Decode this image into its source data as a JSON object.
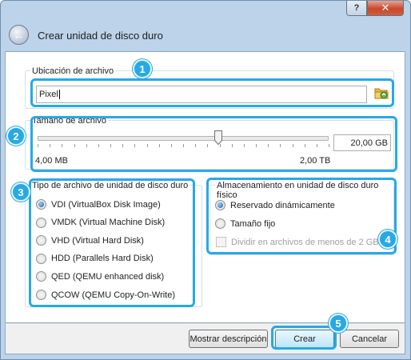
{
  "window": {
    "title": "Crear unidad de disco duro",
    "help_label": "?",
    "close_label": "✕"
  },
  "file_location": {
    "group_label": "Ubicación de archivo",
    "value": "Pixel",
    "browse_icon": "folder-icon"
  },
  "file_size": {
    "group_label": "Tamaño de archivo",
    "value": "20,00 GB",
    "min_label": "4,00 MB",
    "max_label": "2,00 TB",
    "slider_fraction": 0.62
  },
  "file_type": {
    "group_label": "Tipo de archivo de unidad de disco duro",
    "options": [
      {
        "label": "VDI (VirtualBox Disk Image)",
        "checked": true
      },
      {
        "label": "VMDK (Virtual Machine Disk)",
        "checked": false
      },
      {
        "label": "VHD (Virtual Hard Disk)",
        "checked": false
      },
      {
        "label": "HDD (Parallels Hard Disk)",
        "checked": false
      },
      {
        "label": "QED (QEMU enhanced disk)",
        "checked": false
      },
      {
        "label": "QCOW (QEMU Copy-On-Write)",
        "checked": false
      }
    ]
  },
  "storage": {
    "group_label": "Almacenamiento en unidad de disco duro físico",
    "options": [
      {
        "label": "Reservado dinámicamente",
        "checked": true
      },
      {
        "label": "Tamaño fijo",
        "checked": false
      }
    ],
    "split_label": "Dividir en archivos de menos de 2 GB"
  },
  "buttons": {
    "show_description": "Mostrar descripción",
    "create": "Crear",
    "cancel": "Cancelar"
  },
  "badges": [
    "1",
    "2",
    "3",
    "4",
    "5"
  ],
  "colors": {
    "highlight": "#27a9e6"
  }
}
